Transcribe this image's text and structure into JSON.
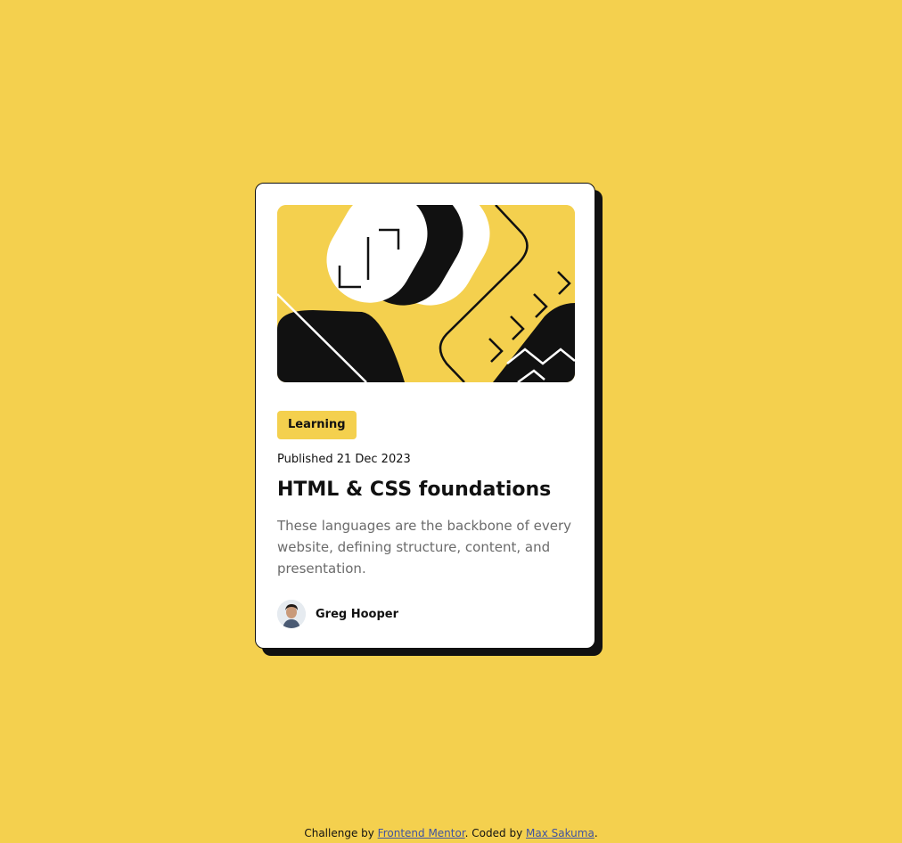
{
  "colors": {
    "background": "#f4d04e",
    "card": "#ffffff",
    "ink": "#111111",
    "muted": "#6b6b6b",
    "link": "#3e52a3"
  },
  "card": {
    "hero_illustration": "abstract-yellow-black-illustration",
    "tag": "Learning",
    "published": "Published 21 Dec 2023",
    "title": "HTML & CSS foundations",
    "description": "These languages are the backbone of every website, defining structure, content, and presentation.",
    "author": {
      "name": "Greg Hooper",
      "avatar_icon": "avatar-photo"
    }
  },
  "attribution": {
    "prefix": "Challenge by ",
    "challenge_link": "Frontend Mentor",
    "middle": ". Coded by ",
    "author_link": "Max Sakuma",
    "suffix": "."
  }
}
